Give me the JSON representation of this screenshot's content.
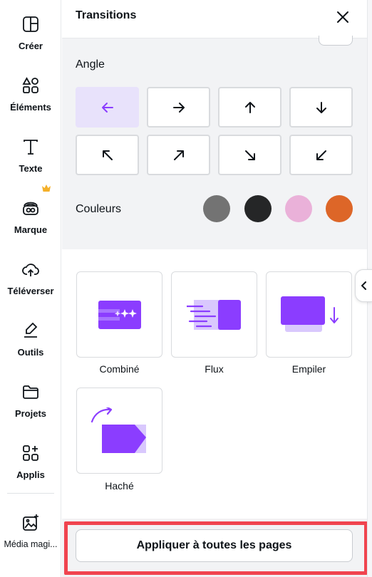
{
  "rail": {
    "items": [
      {
        "label": "Créer",
        "icon": "create-icon"
      },
      {
        "label": "Éléments",
        "icon": "elements-icon"
      },
      {
        "label": "Texte",
        "icon": "text-icon"
      },
      {
        "label": "Marque",
        "icon": "brand-icon"
      },
      {
        "label": "Téléverser",
        "icon": "upload-cloud-icon"
      },
      {
        "label": "Outils",
        "icon": "tools-icon"
      },
      {
        "label": "Projets",
        "icon": "folder-icon"
      },
      {
        "label": "Applis",
        "icon": "apps-icon"
      },
      {
        "label": "Média magi...",
        "icon": "magic-media-icon"
      }
    ],
    "premium_badge_color": "#f4b02a"
  },
  "panel": {
    "title": "Transitions",
    "angle_label": "Angle",
    "angle_options": [
      {
        "direction": "left",
        "glyph": "←",
        "selected": true
      },
      {
        "direction": "right",
        "glyph": "→",
        "selected": false
      },
      {
        "direction": "up",
        "glyph": "↑",
        "selected": false
      },
      {
        "direction": "down",
        "glyph": "↓",
        "selected": false
      },
      {
        "direction": "up-left",
        "glyph": "↖",
        "selected": false
      },
      {
        "direction": "up-right",
        "glyph": "↗",
        "selected": false
      },
      {
        "direction": "down-right",
        "glyph": "↘",
        "selected": false
      },
      {
        "direction": "down-left",
        "glyph": "↙",
        "selected": false
      }
    ],
    "colors_label": "Couleurs",
    "colors": [
      "#737373",
      "#252627",
      "#eab1d9",
      "#dd6628"
    ],
    "transitions": [
      {
        "label": "Combiné",
        "icon": "combine-transition-icon"
      },
      {
        "label": "Flux",
        "icon": "flow-transition-icon"
      },
      {
        "label": "Empiler",
        "icon": "stack-transition-icon"
      },
      {
        "label": "Haché",
        "icon": "chop-transition-icon"
      }
    ],
    "apply_label": "Appliquer à toutes les pages"
  },
  "colors": {
    "accent": "#8b3dff",
    "accent_light": "#d4c4fb",
    "selected_bg": "#e8e2fb",
    "highlight": "#f0444f"
  }
}
